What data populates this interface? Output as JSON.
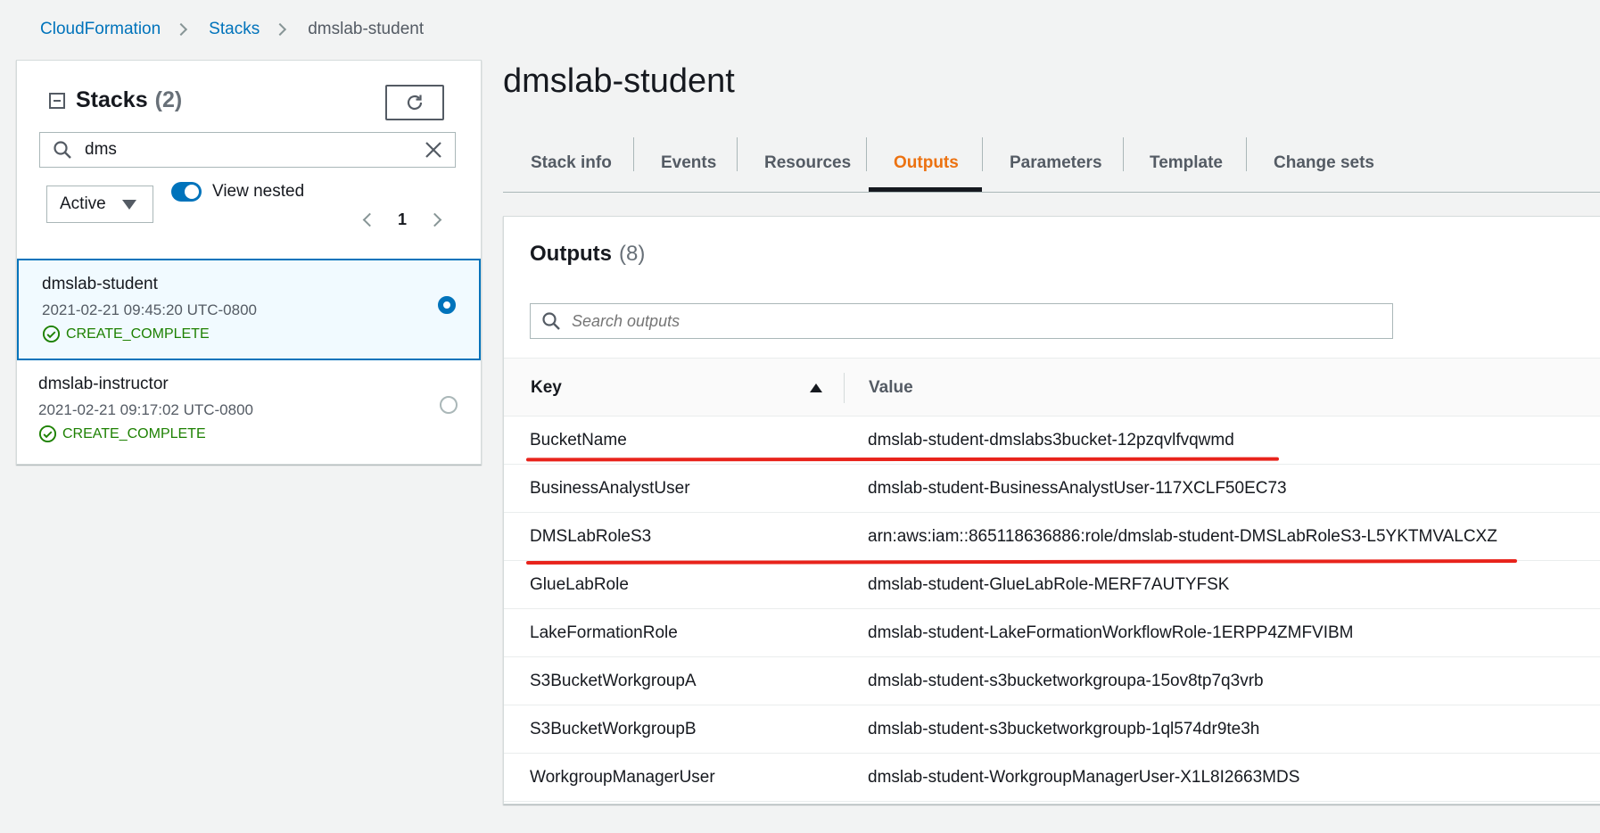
{
  "breadcrumb": {
    "items": [
      "CloudFormation",
      "Stacks"
    ],
    "current": "dmslab-student"
  },
  "stacks_panel": {
    "title": "Stacks",
    "count": "(2)",
    "search_value": "dms",
    "status_filter": "Active",
    "toggle_label": "View nested",
    "toggle_on": true,
    "page": "1",
    "items": [
      {
        "name": "dmslab-student",
        "timestamp": "2021-02-21 09:45:20 UTC-0800",
        "status": "CREATE_COMPLETE",
        "selected": true
      },
      {
        "name": "dmslab-instructor",
        "timestamp": "2021-02-21 09:17:02 UTC-0800",
        "status": "CREATE_COMPLETE",
        "selected": false
      }
    ]
  },
  "main": {
    "title": "dmslab-student",
    "tabs": [
      {
        "label": "Stack info"
      },
      {
        "label": "Events"
      },
      {
        "label": "Resources"
      },
      {
        "label": "Outputs",
        "active": true
      },
      {
        "label": "Parameters"
      },
      {
        "label": "Template"
      },
      {
        "label": "Change sets"
      }
    ]
  },
  "outputs": {
    "title": "Outputs",
    "count": "(8)",
    "search_placeholder": "Search outputs",
    "columns": {
      "key": "Key",
      "value": "Value"
    },
    "rows": [
      {
        "key": "BucketName",
        "value": "dmslab-student-dmslabs3bucket-12pzqvlfvqwmd",
        "highlighted": true
      },
      {
        "key": "BusinessAnalystUser",
        "value": "dmslab-student-BusinessAnalystUser-117XCLF50EC73"
      },
      {
        "key": "DMSLabRoleS3",
        "value": "arn:aws:iam::865118636886:role/dmslab-student-DMSLabRoleS3-L5YKTMVALCXZ",
        "highlighted": true
      },
      {
        "key": "GlueLabRole",
        "value": "dmslab-student-GlueLabRole-MERF7AUTYFSK"
      },
      {
        "key": "LakeFormationRole",
        "value": "dmslab-student-LakeFormationWorkflowRole-1ERPP4ZMFVIBM"
      },
      {
        "key": "S3BucketWorkgroupA",
        "value": "dmslab-student-s3bucketworkgroupa-15ov8tp7q3vrb"
      },
      {
        "key": "S3BucketWorkgroupB",
        "value": "dmslab-student-s3bucketworkgroupb-1ql574dr9te3h"
      },
      {
        "key": "WorkgroupManagerUser",
        "value": "dmslab-student-WorkgroupManagerUser-X1L8I2663MDS"
      }
    ]
  },
  "colors": {
    "link": "#0073bb",
    "active_tab": "#ec7211",
    "success": "#1d8102",
    "annotation": "#e8231b"
  }
}
